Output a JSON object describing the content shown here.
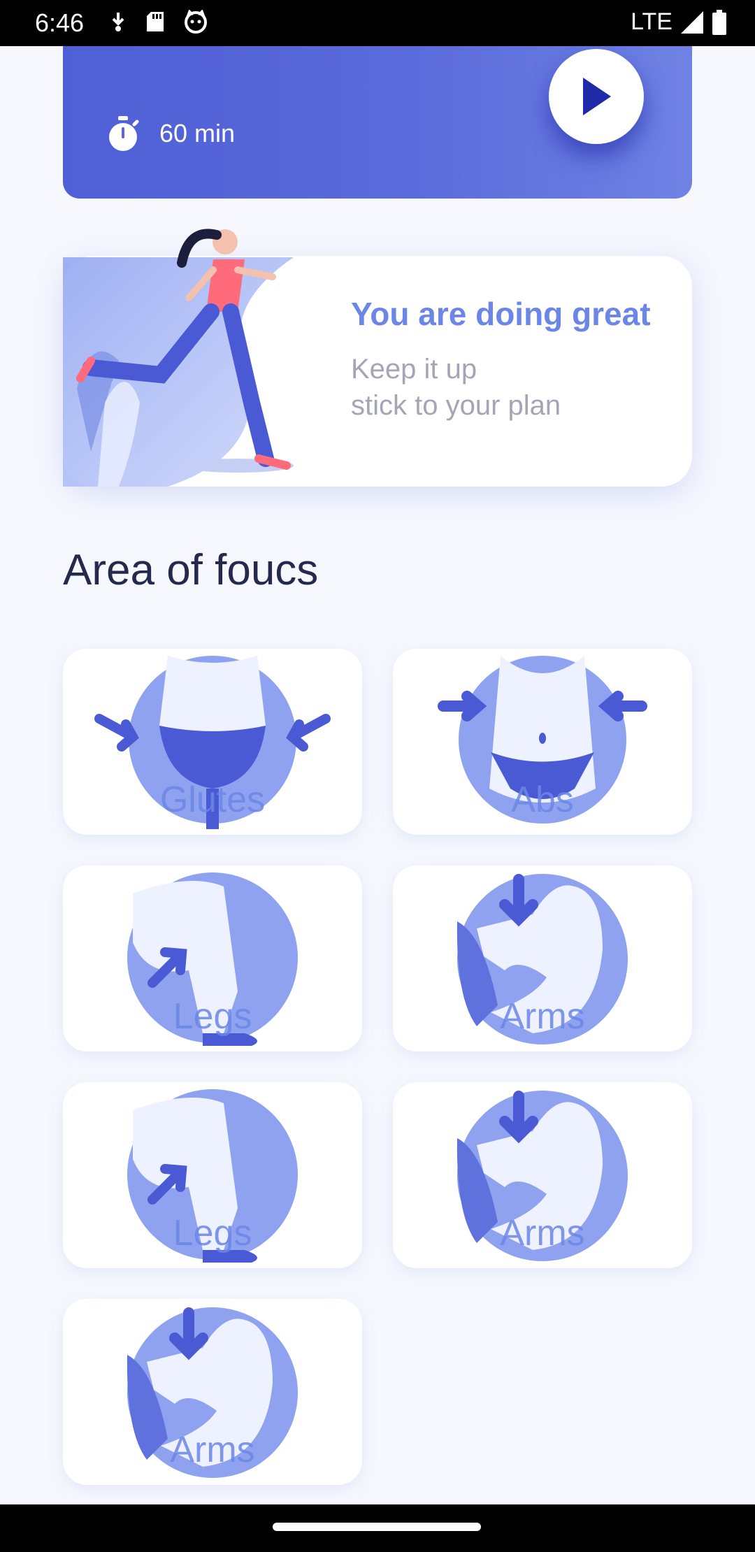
{
  "status_bar": {
    "time": "6:46",
    "network": "LTE",
    "icons": [
      "download-icon",
      "sd-card-icon",
      "cat-icon",
      "signal-icon",
      "battery-icon"
    ]
  },
  "workout": {
    "duration": "60 min",
    "icons": [
      "timer-icon",
      "play-icon"
    ]
  },
  "motivation": {
    "title": "You are doing great",
    "line1": "Keep it up",
    "line2": "stick to your plan"
  },
  "section_title": "Area of foucs",
  "focus_items": [
    {
      "label": "Glutes",
      "icon": "glutes-icon"
    },
    {
      "label": "Abs",
      "icon": "abs-icon"
    },
    {
      "label": "Legs",
      "icon": "legs-icon"
    },
    {
      "label": "Arms",
      "icon": "arms-icon"
    },
    {
      "label": "Legs",
      "icon": "legs-icon"
    },
    {
      "label": "Arms",
      "icon": "arms-icon"
    },
    {
      "label": "Arms",
      "icon": "arms-icon"
    }
  ],
  "colors": {
    "accent": "#6b86e6",
    "card_gradient_start": "#4f5fd6",
    "card_gradient_end": "#6f82e4",
    "title_text": "#252a4d",
    "muted_text": "#a4a6b6",
    "background": "#f6f8fe"
  }
}
